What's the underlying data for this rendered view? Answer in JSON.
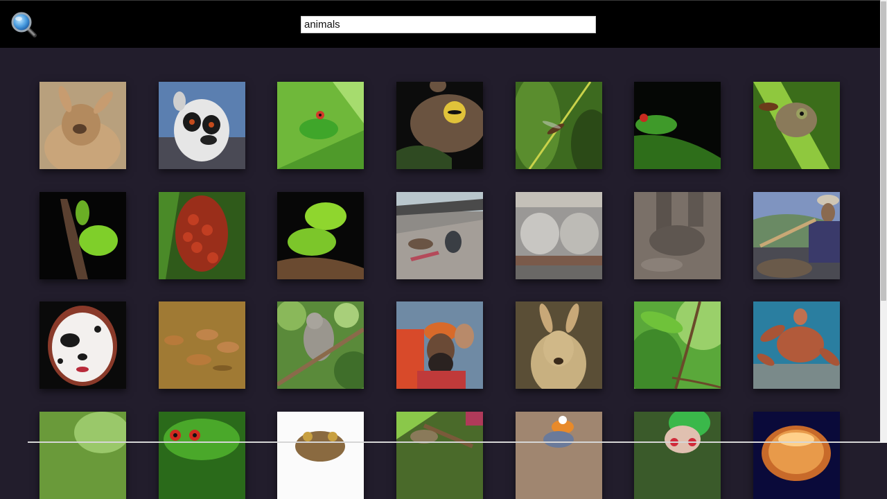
{
  "header": {
    "search_icon": "search-icon",
    "search_value": "animals",
    "background": "#000000"
  },
  "page": {
    "background": "#221d2c"
  },
  "gallery": {
    "items": [
      {
        "name": "kangaroo-lying"
      },
      {
        "name": "ring-tailed-lemur"
      },
      {
        "name": "green-tree-frog-on-leaf"
      },
      {
        "name": "brown-frog-yellow-eyes"
      },
      {
        "name": "insect-on-grass-stem"
      },
      {
        "name": "red-eyed-frog-dark"
      },
      {
        "name": "brown-frog-on-leaf"
      },
      {
        "name": "green-lizard-on-branch"
      },
      {
        "name": "red-bugs-on-plant"
      },
      {
        "name": "green-lizard-on-log"
      },
      {
        "name": "boy-with-animals-on-shore"
      },
      {
        "name": "cattle-and-sacks"
      },
      {
        "name": "elephant-feet-in-mud"
      },
      {
        "name": "snake-charmer-flute"
      },
      {
        "name": "girl-dalmatian-face-paint"
      },
      {
        "name": "ducks-in-water"
      },
      {
        "name": "koala-on-branch"
      },
      {
        "name": "man-with-monkeys"
      },
      {
        "name": "kangaroo-portrait"
      },
      {
        "name": "lizard-on-twig"
      },
      {
        "name": "sea-turtle"
      },
      {
        "name": "green-thumbnail"
      },
      {
        "name": "red-eyed-tree-frog"
      },
      {
        "name": "toad-on-white"
      },
      {
        "name": "frog-on-stem"
      },
      {
        "name": "toy-on-brown"
      },
      {
        "name": "christmas-elf"
      },
      {
        "name": "glowing-orb"
      }
    ]
  }
}
